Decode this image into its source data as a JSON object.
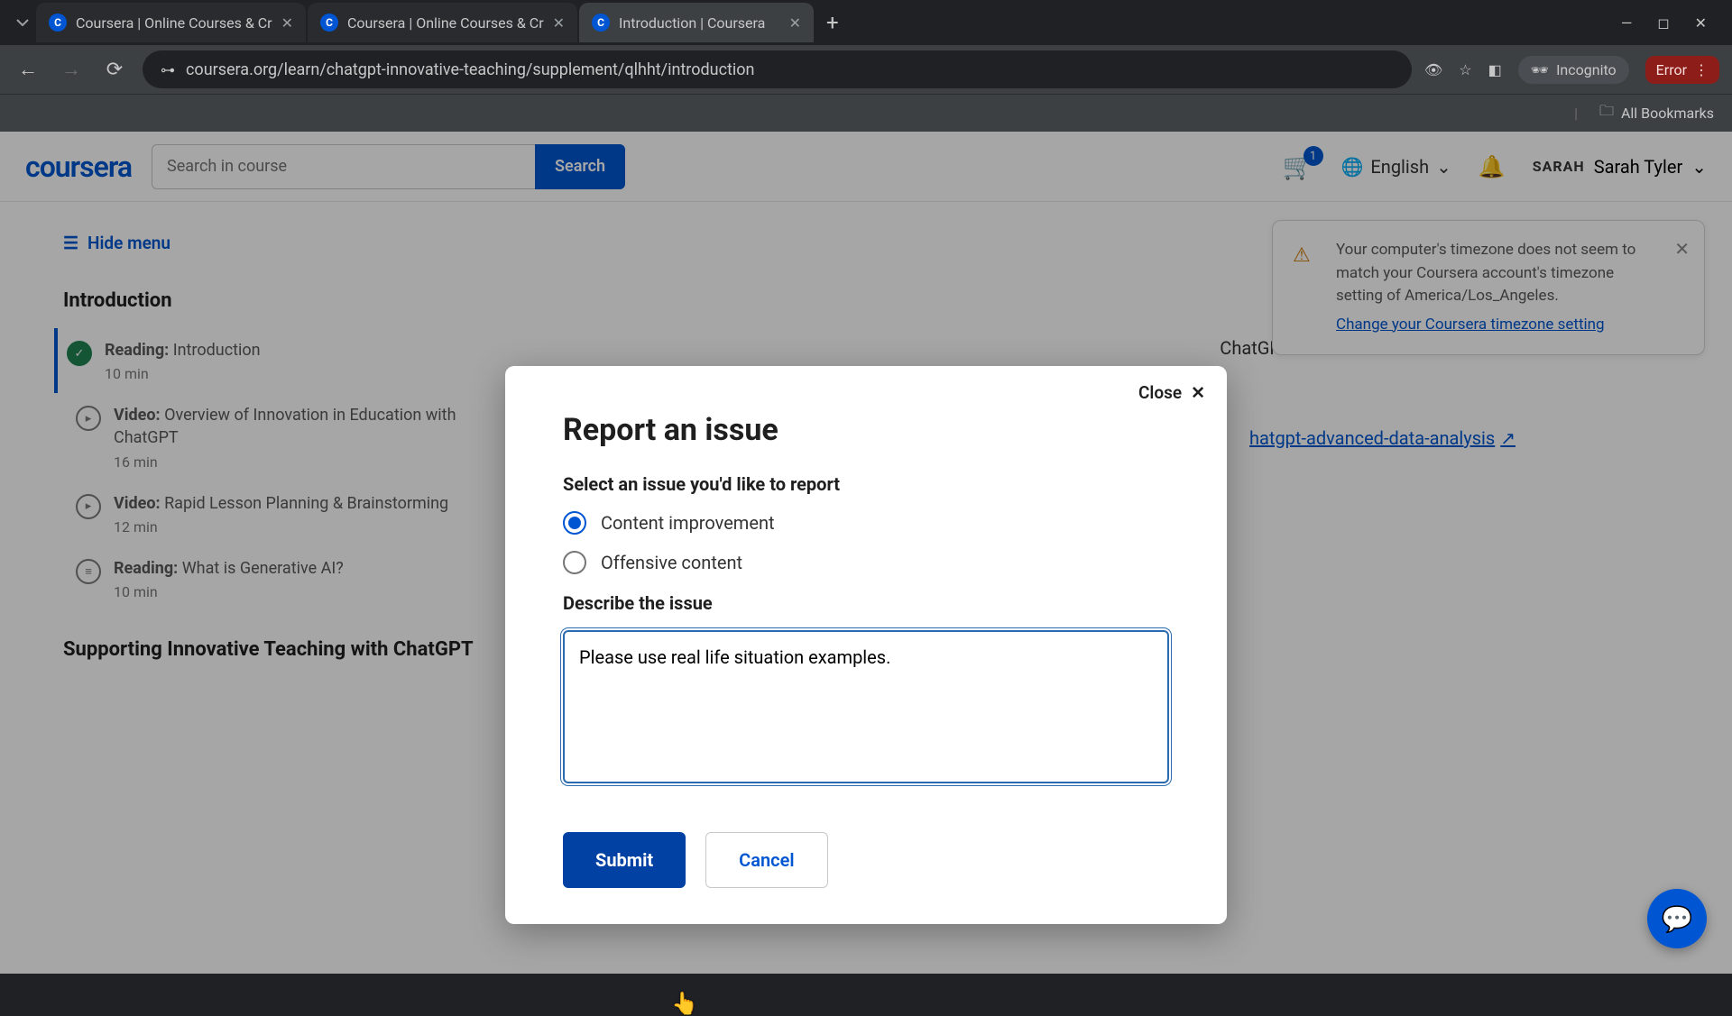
{
  "browser": {
    "tabs": [
      {
        "title": "Coursera | Online Courses & Cr"
      },
      {
        "title": "Coursera | Online Courses & Cr"
      },
      {
        "title": "Introduction | Coursera"
      }
    ],
    "url": "coursera.org/learn/chatgpt-innovative-teaching/supplement/qlhht/introduction",
    "incognito_label": "Incognito",
    "error_label": "Error",
    "bookmarks_label": "All Bookmarks"
  },
  "header": {
    "logo": "coursera",
    "search_placeholder": "Search in course",
    "search_button": "Search",
    "cart_count": "1",
    "language": "English",
    "user_badge": "SARAH",
    "user_name": "Sarah Tyler"
  },
  "sidebar": {
    "hide_menu": "Hide menu",
    "section1_title": "Introduction",
    "lessons": [
      {
        "kind": "Reading:",
        "title": "Introduction",
        "duration": "10 min",
        "icon": "check"
      },
      {
        "kind": "Video:",
        "title": "Overview of Innovation in Education with ChatGPT",
        "duration": "16 min",
        "icon": "play"
      },
      {
        "kind": "Video:",
        "title": "Rapid Lesson Planning & Brainstorming",
        "duration": "12 min",
        "icon": "play"
      },
      {
        "kind": "Reading:",
        "title": "What is Generative AI?",
        "duration": "10 min",
        "icon": "doc"
      }
    ],
    "section2_title": "Supporting Innovative Teaching with ChatGPT"
  },
  "main": {
    "bg_text_fragment": "ChatGP",
    "bg_link_text": "hatgpt-advanced-data-analysis",
    "tz_banner": {
      "text": "Your computer's timezone does not seem to match your Coursera account's timezone setting of America/Los_Angeles.",
      "link": "Change your Coursera timezone setting"
    }
  },
  "modal": {
    "close": "Close",
    "title": "Report an issue",
    "select_label": "Select an issue you'd like to report",
    "option1": "Content improvement",
    "option2": "Offensive content",
    "describe_label": "Describe the issue",
    "textarea_value": "Please use real life situation examples.",
    "submit": "Submit",
    "cancel": "Cancel"
  }
}
